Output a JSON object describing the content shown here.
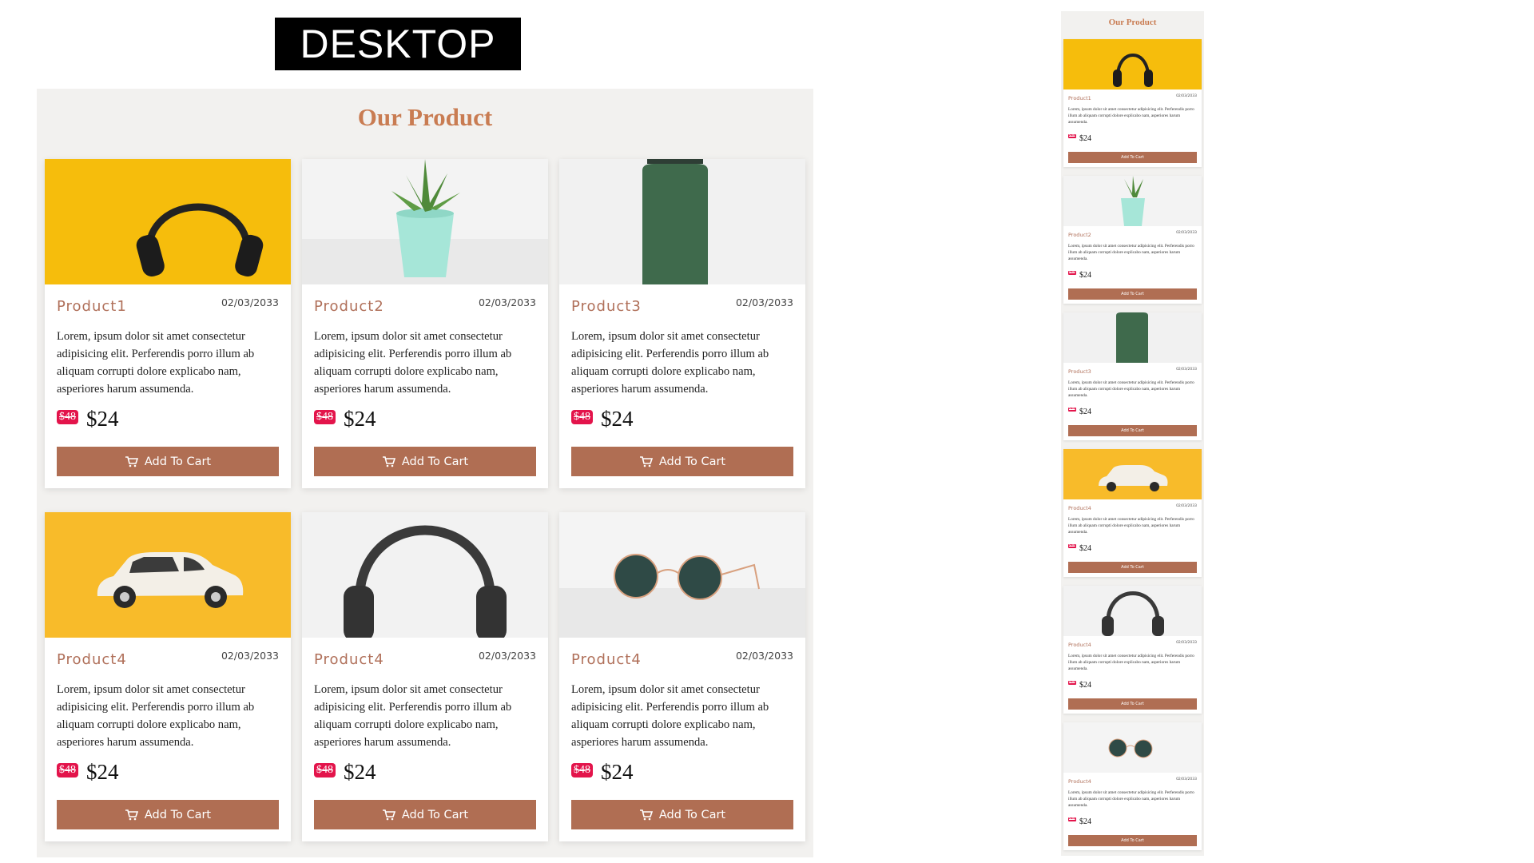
{
  "banner": {
    "label": "DESKTOP"
  },
  "section": {
    "title": "Our Product"
  },
  "colors": {
    "accent": "#c97c52",
    "button": "#b06e53",
    "sale_badge": "#e3144b",
    "panel_bg": "#f2f1ef"
  },
  "products": [
    {
      "name": "Product1",
      "date": "02/03/2033",
      "description": "Lorem, ipsum dolor sit amet consectetur adipisicing elit. Perferendis porro illum ab aliquam corrupti dolore explicabo nam, asperiores harum assumenda.",
      "old_price": "$48",
      "price": "$24",
      "button": "Add To Cart",
      "image": "headphones-on-yellow"
    },
    {
      "name": "Product2",
      "date": "02/03/2033",
      "description": "Lorem, ipsum dolor sit amet consectetur adipisicing elit. Perferendis porro illum ab aliquam corrupti dolore explicabo nam, asperiores harum assumenda.",
      "old_price": "$48",
      "price": "$24",
      "button": "Add To Cart",
      "image": "succulent-in-mint-pot"
    },
    {
      "name": "Product3",
      "date": "02/03/2033",
      "description": "Lorem, ipsum dolor sit amet consectetur adipisicing elit. Perferendis porro illum ab aliquam corrupti dolore explicabo nam, asperiores harum assumenda.",
      "old_price": "$48",
      "price": "$24",
      "button": "Add To Cart",
      "image": "green-bottle"
    },
    {
      "name": "Product4",
      "date": "02/03/2033",
      "description": "Lorem, ipsum dolor sit amet consectetur adipisicing elit. Perferendis porro illum ab aliquam corrupti dolore explicabo nam, asperiores harum assumenda.",
      "old_price": "$48",
      "price": "$24",
      "button": "Add To Cart",
      "image": "toy-car-on-yellow"
    },
    {
      "name": "Product4",
      "date": "02/03/2033",
      "description": "Lorem, ipsum dolor sit amet consectetur adipisicing elit. Perferendis porro illum ab aliquam corrupti dolore explicabo nam, asperiores harum assumenda.",
      "old_price": "$48",
      "price": "$24",
      "button": "Add To Cart",
      "image": "grey-headphones"
    },
    {
      "name": "Product4",
      "date": "02/03/2033",
      "description": "Lorem, ipsum dolor sit amet consectetur adipisicing elit. Perferendis porro illum ab aliquam corrupti dolore explicabo nam, asperiores harum assumenda.",
      "old_price": "$48",
      "price": "$24",
      "button": "Add To Cart",
      "image": "sunglasses-on-marble"
    }
  ],
  "mobile": {
    "title": "Our Product",
    "products": [
      {
        "name": "Product1",
        "date": "02/03/2033",
        "description": "Lorem, ipsum dolor sit amet consectetur adipisicing elit. Perferendis porro illum ab aliquam corrupti dolore explicabo nam, asperiores harum assumenda.",
        "old_price": "$48",
        "price": "$24",
        "button": "Add To Cart"
      },
      {
        "name": "Product2",
        "date": "02/03/2033",
        "description": "Lorem, ipsum dolor sit amet consectetur adipisicing elit. Perferendis porro illum ab aliquam corrupti dolore explicabo nam, asperiores harum assumenda.",
        "old_price": "$48",
        "price": "$24",
        "button": "Add To Cart"
      },
      {
        "name": "Product3",
        "date": "02/03/2033",
        "description": "Lorem, ipsum dolor sit amet consectetur adipisicing elit. Perferendis porro illum ab aliquam corrupti dolore explicabo nam, asperiores harum assumenda.",
        "old_price": "$48",
        "price": "$24",
        "button": "Add To Cart"
      },
      {
        "name": "Product4",
        "date": "02/03/2033",
        "description": "Lorem, ipsum dolor sit amet consectetur adipisicing elit. Perferendis porro illum ab aliquam corrupti dolore explicabo nam, asperiores harum assumenda.",
        "old_price": "$48",
        "price": "$24",
        "button": "Add To Cart"
      },
      {
        "name": "Product4",
        "date": "02/03/2033",
        "description": "Lorem, ipsum dolor sit amet consectetur adipisicing elit. Perferendis porro illum ab aliquam corrupti dolore explicabo nam, asperiores harum assumenda.",
        "old_price": "$48",
        "price": "$24",
        "button": "Add To Cart"
      },
      {
        "name": "Product4",
        "date": "02/03/2033",
        "description": "Lorem, ipsum dolor sit amet consectetur adipisicing elit. Perferendis porro illum ab aliquam corrupti dolore explicabo nam, asperiores harum assumenda.",
        "old_price": "$48",
        "price": "$24",
        "button": "Add To Cart"
      }
    ]
  }
}
